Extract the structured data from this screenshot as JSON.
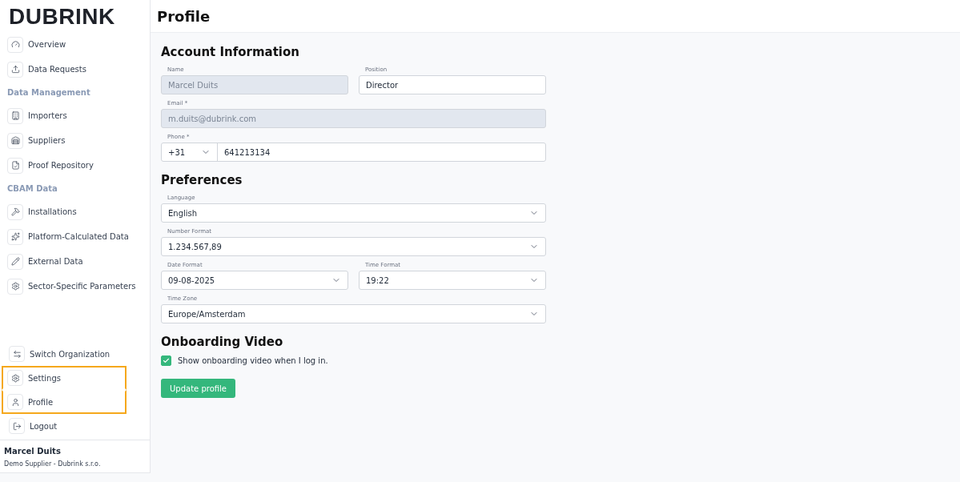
{
  "sidebar": {
    "logo": "DUBRINK",
    "sections": [
      {
        "items": [
          {
            "label": "Overview"
          },
          {
            "label": "Data Requests"
          }
        ]
      },
      {
        "title": "Data Management",
        "items": [
          {
            "label": "Importers"
          },
          {
            "label": "Suppliers"
          },
          {
            "label": "Proof Repository"
          }
        ]
      },
      {
        "title": "CBAM Data",
        "items": [
          {
            "label": "Installations"
          },
          {
            "label": "Platform-Calculated Data"
          },
          {
            "label": "External Data"
          },
          {
            "label": "Sector-Specific Parameters"
          }
        ]
      }
    ],
    "bottom_items": [
      {
        "label": "Switch Organization",
        "highlighted": false
      },
      {
        "label": "Settings",
        "highlighted": true
      },
      {
        "label": "Profile",
        "highlighted": true
      },
      {
        "label": "Logout",
        "highlighted": false
      }
    ],
    "user": {
      "name": "Marcel Duits",
      "organization": "Demo Supplier - Dubrink s.r.o."
    }
  },
  "page": {
    "title": "Profile",
    "account": {
      "heading": "Account Information",
      "name": {
        "label": "Name",
        "value": "Marcel Duits",
        "disabled": true
      },
      "position": {
        "label": "Position",
        "value": "Director",
        "disabled": false
      },
      "email": {
        "label": "Email *",
        "value": "m.duits@dubrink.com",
        "disabled": true
      },
      "phone": {
        "label": "Phone *",
        "country_code": "+31",
        "value": "641213134"
      }
    },
    "preferences": {
      "heading": "Preferences",
      "language": {
        "label": "Language",
        "value": "English"
      },
      "number_format": {
        "label": "Number Format",
        "value": "1.234.567,89"
      },
      "date_format": {
        "label": "Date Format",
        "value": "09-08-2025"
      },
      "time_format": {
        "label": "Time Format",
        "value": "19:22"
      },
      "time_zone": {
        "label": "Time Zone",
        "value": "Europe/Amsterdam"
      }
    },
    "onboarding": {
      "heading": "Onboarding Video",
      "checkbox": {
        "label": "Show onboarding video when I log in.",
        "checked": true
      }
    },
    "submit": "Update profile"
  }
}
